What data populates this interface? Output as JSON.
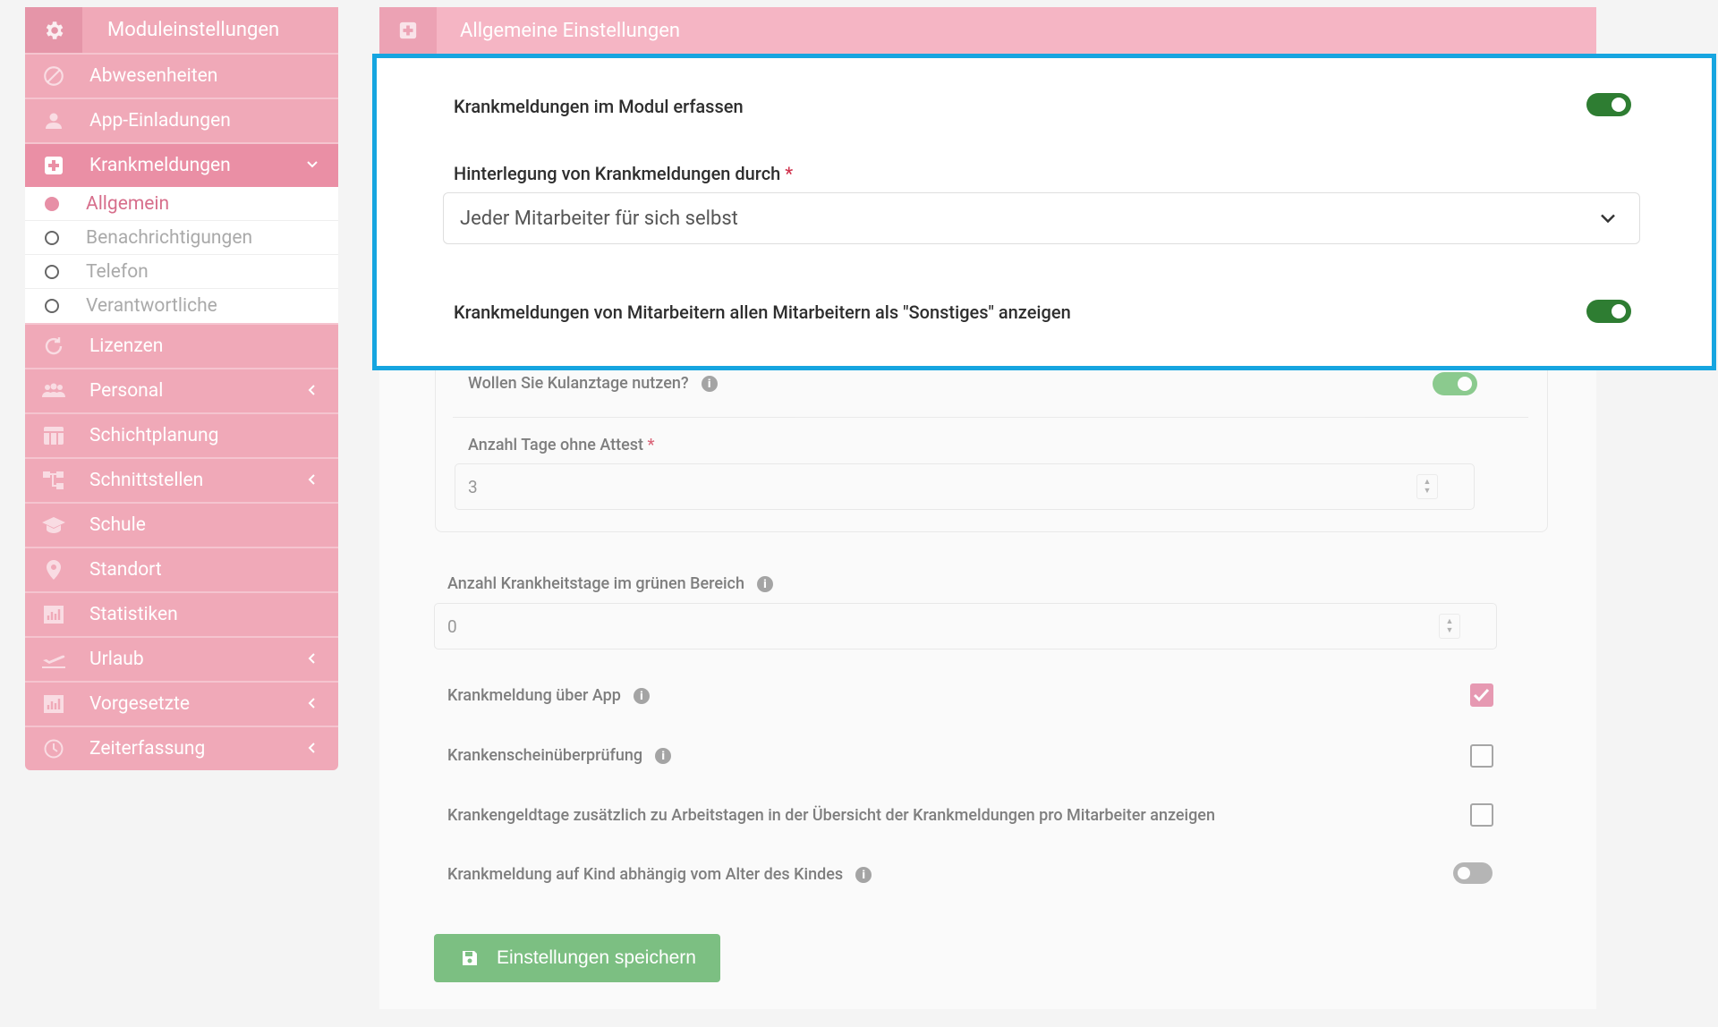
{
  "sidebar": {
    "header": "Moduleinstellungen",
    "items": [
      {
        "label": "Abwesenheiten"
      },
      {
        "label": "App-Einladungen"
      },
      {
        "label": "Krankmeldungen"
      },
      {
        "label": "Lizenzen"
      },
      {
        "label": "Personal"
      },
      {
        "label": "Schichtplanung"
      },
      {
        "label": "Schnittstellen"
      },
      {
        "label": "Schule"
      },
      {
        "label": "Standort"
      },
      {
        "label": "Statistiken"
      },
      {
        "label": "Urlaub"
      },
      {
        "label": "Vorgesetzte"
      },
      {
        "label": "Zeiterfassung"
      }
    ],
    "subitems": [
      {
        "label": "Allgemein"
      },
      {
        "label": "Benachrichtigungen"
      },
      {
        "label": "Telefon"
      },
      {
        "label": "Verantwortliche"
      }
    ]
  },
  "main": {
    "header": "Allgemeine Einstellungen",
    "highlight": {
      "toggle1_label": "Krankmeldungen im Modul erfassen",
      "select_label": "Hinterlegung von Krankmeldungen durch",
      "required_mark": "*",
      "select_value": "Jeder Mitarbeiter für sich selbst",
      "toggle2_label": "Krankmeldungen von Mitarbeitern allen Mitarbeitern als \"Sonstiges\" anzeigen"
    },
    "kulanz_label": "Wollen Sie Kulanztage nutzen?",
    "tage_label": "Anzahl Tage ohne Attest",
    "tage_value": "3",
    "gruen_label": "Anzahl Krankheitstage im grünen Bereich",
    "gruen_value": "0",
    "app_label": "Krankmeldung über App",
    "schein_label": "Krankenscheinüberprüfung",
    "geld_label": "Krankengeldtage zusätzlich zu Arbeitstagen in der Übersicht der Krankmeldungen pro Mitarbeiter anzeigen",
    "kind_label": "Krankmeldung auf Kind abhängig vom Alter des Kindes",
    "info_glyph": "i",
    "save_label": "Einstellungen speichern"
  },
  "colors": {
    "sidebar_pink": "#f0a9b8",
    "accent_pink": "#e0799a",
    "toggle_green": "#2e7d32",
    "save_green": "#7cbf82",
    "highlight_blue": "#16a5e0"
  }
}
